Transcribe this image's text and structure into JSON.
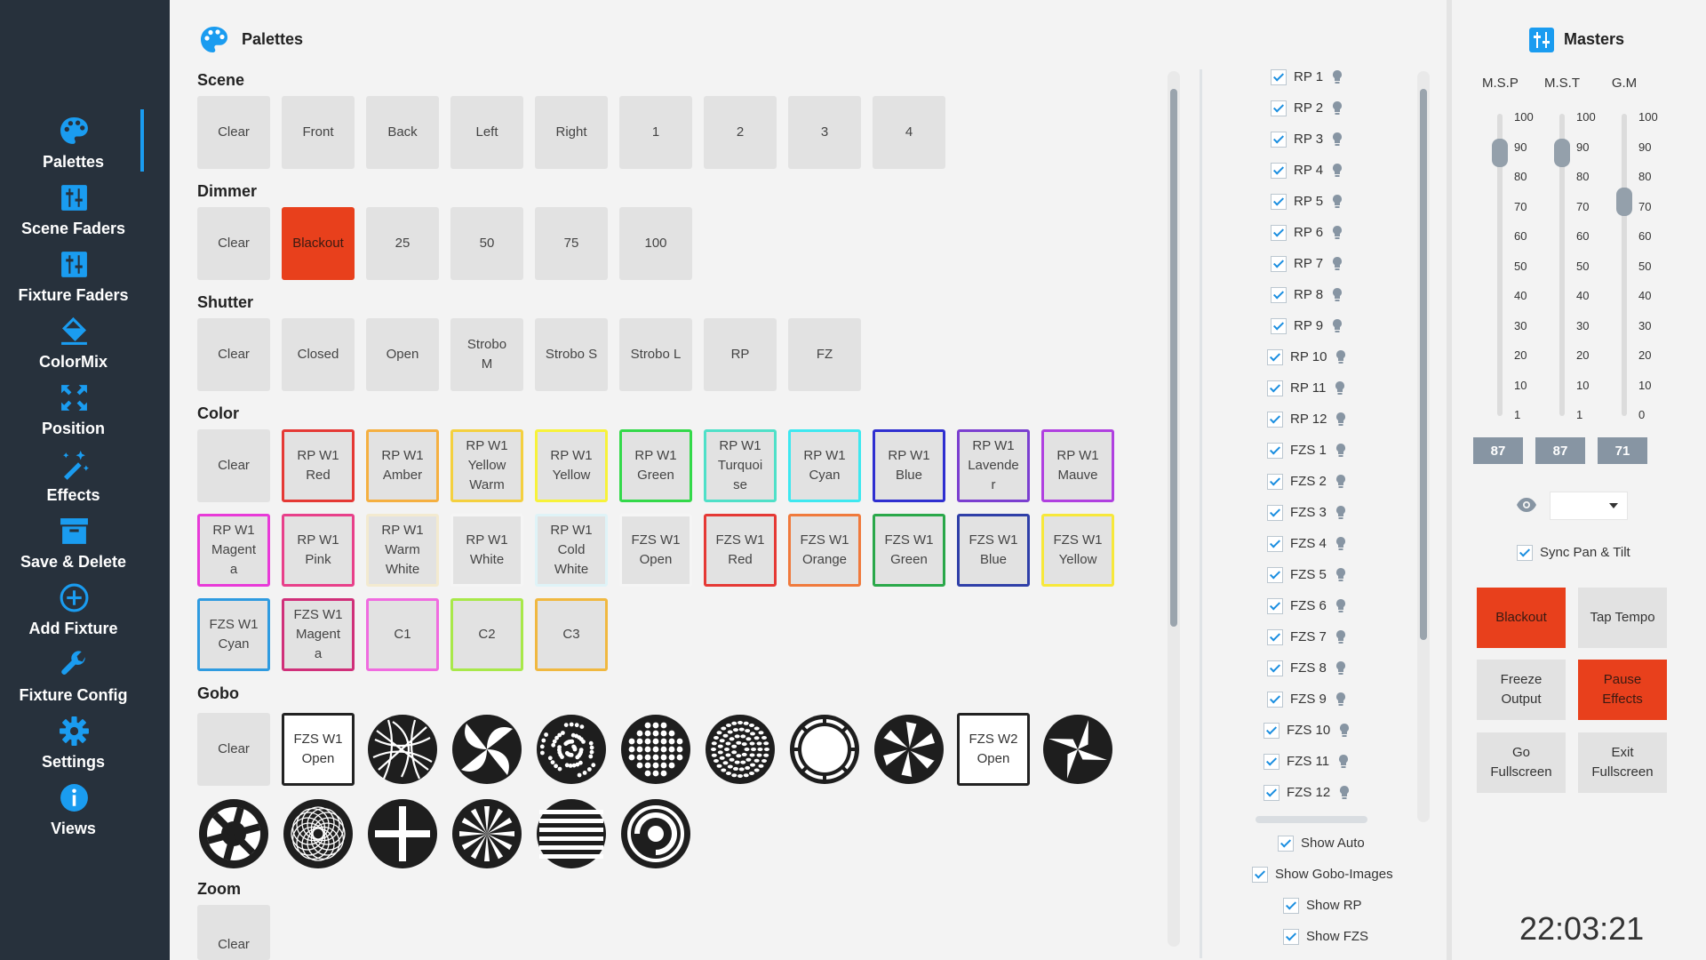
{
  "nav": [
    {
      "label": "Palettes",
      "icon": "palette-icon"
    },
    {
      "label": "Scene Faders",
      "icon": "sliders-icon"
    },
    {
      "label": "Fixture Faders",
      "icon": "sliders-icon"
    },
    {
      "label": "ColorMix",
      "icon": "paint-bucket-icon"
    },
    {
      "label": "Position",
      "icon": "arrows-expand-icon"
    },
    {
      "label": "Effects",
      "icon": "magic-wand-icon"
    },
    {
      "label": "Save & Delete",
      "icon": "archive-icon"
    },
    {
      "label": "Add Fixture",
      "icon": "plus-circle-icon"
    },
    {
      "label": "Fixture Config",
      "icon": "wrench-icon"
    },
    {
      "label": "Settings",
      "icon": "gear-icon"
    },
    {
      "label": "Views",
      "icon": "info-icon"
    }
  ],
  "palettes": {
    "title": "Palettes",
    "sections": {
      "scene": {
        "title": "Scene",
        "items": [
          "Clear",
          "Front",
          "Back",
          "Left",
          "Right",
          "1",
          "2",
          "3",
          "4"
        ]
      },
      "dimmer": {
        "title": "Dimmer",
        "items": [
          "Clear",
          "Blackout",
          "25",
          "50",
          "75",
          "100"
        ]
      },
      "shutter": {
        "title": "Shutter",
        "items": [
          "Clear",
          "Closed",
          "Open",
          "Strobo\nM",
          "Strobo S",
          "Strobo L",
          "RP",
          "FZ"
        ]
      },
      "color": {
        "title": "Color",
        "items": [
          {
            "label": "Clear",
            "color": ""
          },
          {
            "label": "RP W1\nRed",
            "color": "#e53935"
          },
          {
            "label": "RP W1\nAmber",
            "color": "#f5b041"
          },
          {
            "label": "RP W1\nYellow\nWarm",
            "color": "#f4d03f"
          },
          {
            "label": "RP W1\nYellow",
            "color": "#f7f23a"
          },
          {
            "label": "RP W1\nGreen",
            "color": "#33d94a"
          },
          {
            "label": "RP W1\nTurquoi\nse",
            "color": "#4fe0c8"
          },
          {
            "label": "RP W1\nCyan",
            "color": "#3ee8f0"
          },
          {
            "label": "RP W1\nBlue",
            "color": "#2f2fd0"
          },
          {
            "label": "RP W1\nLavende\nr",
            "color": "#7b3fd0"
          },
          {
            "label": "RP W1\nMauve",
            "color": "#b040e0"
          },
          {
            "label": "RP W1\nMagent\na",
            "color": "#e83ad8"
          },
          {
            "label": "RP W1\nPink",
            "color": "#e8408a"
          },
          {
            "label": "RP W1\nWarm\nWhite",
            "color": "#f3ead0"
          },
          {
            "label": "RP W1\nWhite",
            "color": "#f5f5f5"
          },
          {
            "label": "RP W1\nCold\nWhite",
            "color": "#dff3f7"
          },
          {
            "label": "FZS W1\nOpen",
            "color": "#f5f5f5"
          },
          {
            "label": "FZS W1\nRed",
            "color": "#e53935"
          },
          {
            "label": "FZS W1\nOrange",
            "color": "#f07a3c"
          },
          {
            "label": "FZS W1\nGreen",
            "color": "#2aa84a"
          },
          {
            "label": "FZS W1\nBlue",
            "color": "#2f3fa8"
          },
          {
            "label": "FZS W1\nYellow",
            "color": "#f7e83a"
          },
          {
            "label": "FZS W1\nCyan",
            "color": "#2f9be0"
          },
          {
            "label": "FZS W1\nMagent\na",
            "color": "#d0307a"
          },
          {
            "label": "C1",
            "color": "#f06ce0"
          },
          {
            "label": "C2",
            "color": "#a8e84a"
          },
          {
            "label": "C3",
            "color": "#f0b840"
          }
        ]
      },
      "gobo": {
        "title": "Gobo",
        "clear": "Clear",
        "open1": "FZS W1\nOpen",
        "open2": "FZS W2\nOpen"
      },
      "zoom": {
        "title": "Zoom",
        "items": [
          "Clear"
        ]
      }
    }
  },
  "fixtures": [
    "RP 1",
    "RP 2",
    "RP 3",
    "RP 4",
    "RP 5",
    "RP 6",
    "RP 7",
    "RP 8",
    "RP 9",
    "RP 10",
    "RP 11",
    "RP 12",
    "FZS 1",
    "FZS 2",
    "FZS 3",
    "FZS 4",
    "FZS 5",
    "FZS 6",
    "FZS 7",
    "FZS 8",
    "FZS 9",
    "FZS 10",
    "FZS 11",
    "FZS 12"
  ],
  "options": [
    "Show Auto",
    "Show Gobo-Images",
    "Show RP",
    "Show FZS"
  ],
  "masters": {
    "title": "Masters",
    "faders": [
      {
        "label": "M.S.P",
        "value": 87,
        "display": "87",
        "ticks": [
          "100",
          "90",
          "80",
          "70",
          "60",
          "50",
          "40",
          "30",
          "20",
          "10",
          "1"
        ]
      },
      {
        "label": "M.S.T",
        "value": 87,
        "display": "87",
        "ticks": [
          "100",
          "90",
          "80",
          "70",
          "60",
          "50",
          "40",
          "30",
          "20",
          "10",
          "1"
        ]
      },
      {
        "label": "G.M",
        "value": 71,
        "display": "71",
        "ticks": [
          "100",
          "90",
          "80",
          "70",
          "60",
          "50",
          "40",
          "30",
          "20",
          "10",
          "0"
        ]
      }
    ],
    "sync_label": "Sync Pan & Tilt",
    "buttons": [
      "Blackout",
      "Tap Tempo",
      "Freeze\nOutput",
      "Pause\nEffects",
      "Go\nFullscreen",
      "Exit\nFullscreen"
    ],
    "clock": "22:03:21"
  },
  "colors": {
    "accent": "#1a9cf0",
    "sidebar": "#27313c",
    "red": "#e8401c",
    "fader": "#94a0ab"
  }
}
